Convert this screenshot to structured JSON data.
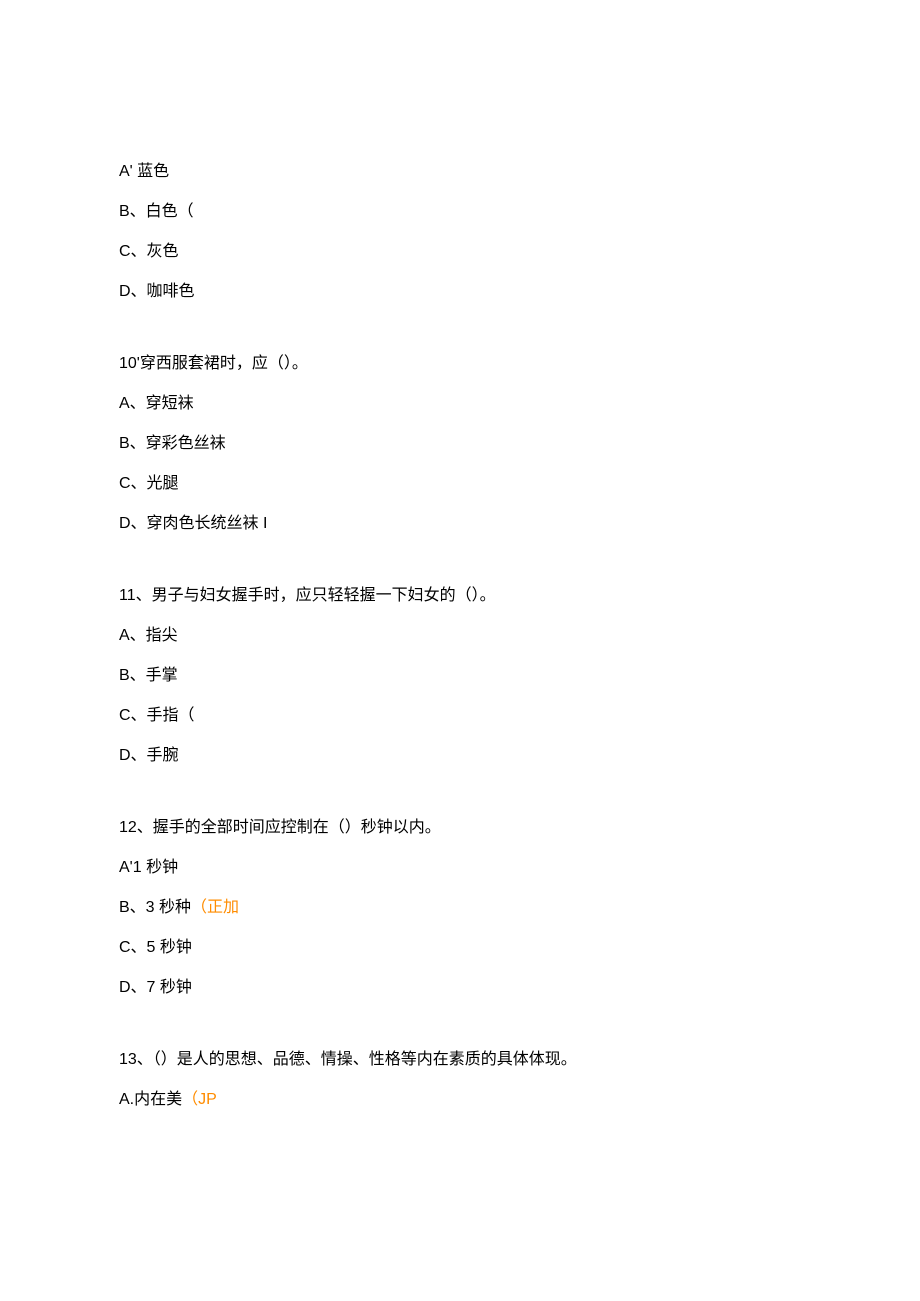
{
  "q9_options": {
    "a": "A' 蓝色",
    "b": "B、白色（",
    "c": "C、灰色",
    "d": "D、咖啡色"
  },
  "q10": {
    "text": "10'穿西服套裙时，应（）。",
    "a": "A、穿短袜",
    "b": "B、穿彩色丝袜",
    "c": "C、光腿",
    "d": "D、穿肉色长统丝袜 I"
  },
  "q11": {
    "text": "11、男子与妇女握手时，应只轻轻握一下妇女的（）。",
    "a": "A、指尖",
    "b": "B、手掌",
    "c": "C、手指（",
    "d": "D、手腕"
  },
  "q12": {
    "text": "12、握手的全部时间应控制在（）秒钟以内。",
    "a": "A'1 秒钟",
    "b_prefix": "B、3 秒种",
    "b_annotation": "（正加",
    "c": "C、5 秒钟",
    "d": "D、7 秒钟"
  },
  "q13": {
    "text": "13、（）是人的思想、品德、情操、性格等内在素质的具体体现。",
    "a_prefix": "A.内在美",
    "a_annotation": "（JP"
  }
}
